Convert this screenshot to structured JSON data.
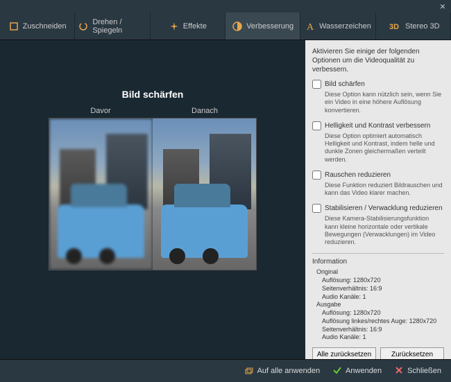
{
  "tabs": {
    "crop": "Zuschneiden",
    "rotate": "Drehen / Spiegeln",
    "effects": "Effekte",
    "enhance": "Verbesserung",
    "watermark": "Wasserzeichen",
    "stereo": "Stereo 3D"
  },
  "preview": {
    "title": "Bild schärfen",
    "before": "Davor",
    "after": "Danach"
  },
  "sidebar": {
    "intro": "Aktivieren Sie einige der folgenden Optionen um die Videoqualität zu verbessern.",
    "options": {
      "sharpen": {
        "label": "Bild schärfen",
        "desc": "Diese Option kann nützlich sein, wenn Sie ein Video in eine höhere Auflösung konvertieren."
      },
      "brightness": {
        "label": "Helligkeit und Kontrast verbessern",
        "desc": "Diese Option optimiert automatisch Helligkeit und Kontrast, indem helle und dunkle Zonen gleichermaßen verteilt werden."
      },
      "noise": {
        "label": "Rauschen reduzieren",
        "desc": "Diese Funktion reduziert Bildrauschen und kann das Video klarer machen."
      },
      "stabilize": {
        "label": "Stabilisieren / Verwacklung reduzieren",
        "desc": "Diese Kamera-Stabilisierungsfunktion kann kleine horizontale oder vertikale Bewegungen (Verwacklungen) im Video reduzieren."
      }
    },
    "info": {
      "title": "Information",
      "original": {
        "label": "Original",
        "resolution": "Auflösung: 1280x720",
        "aspect": "Seitenverhältnis: 16:9",
        "audio": "Audio Kanäle: 1"
      },
      "output": {
        "label": "Ausgabe",
        "resolution": "Auflösung: 1280x720",
        "lr": "Auflösung linkes/rechtes Auge: 1280x720",
        "aspect": "Seitenverhältnis: 16:9",
        "audio": "Audio Kanäle: 1"
      }
    },
    "buttons": {
      "resetAll": "Alle zurücksetzen",
      "reset": "Zurücksetzen"
    }
  },
  "footer": {
    "applyAll": "Auf alle anwenden",
    "apply": "Anwenden",
    "close": "Schließen"
  }
}
